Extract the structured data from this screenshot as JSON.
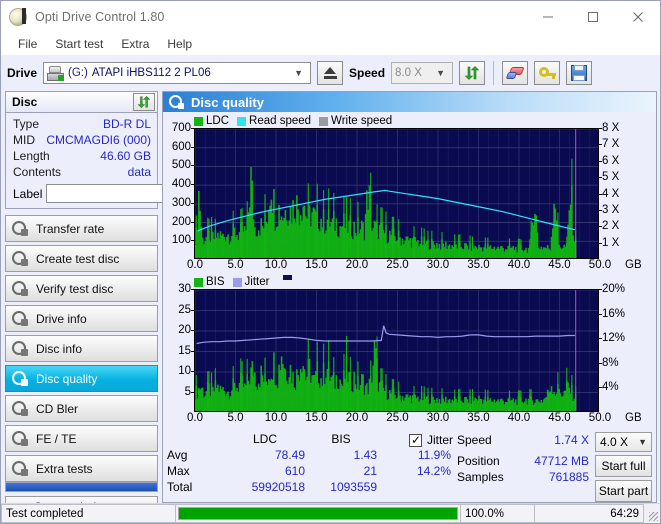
{
  "window": {
    "title": "Opti Drive Control 1.80",
    "icon": "app-disc-icon",
    "minimize": "–",
    "maximize": "□",
    "close": "✕"
  },
  "menu": {
    "items": [
      "File",
      "Start test",
      "Extra",
      "Help"
    ]
  },
  "toolbar": {
    "drive_label": "Drive",
    "drive_letter": "(G:)",
    "drive_name": "ATAPI iHBS112  2 PL06",
    "eject_title": "Eject",
    "speed_label": "Speed",
    "speed_value": "8.0 X",
    "icons": [
      "refresh-icon",
      "eraser-icon",
      "key-icon",
      "save-icon"
    ]
  },
  "disc": {
    "header": "Disc",
    "refresh_icon": "refresh-icon",
    "rows": [
      {
        "key": "Type",
        "value": "BD-R DL"
      },
      {
        "key": "MID",
        "value": "CMCMAGDI6 (000)"
      },
      {
        "key": "Length",
        "value": "46.60 GB"
      },
      {
        "key": "Contents",
        "value": "data"
      }
    ],
    "label_key": "Label",
    "label_value": "",
    "label_placeholder": ""
  },
  "sidebar": {
    "items": [
      {
        "label": "Transfer rate",
        "selected": false
      },
      {
        "label": "Create test disc",
        "selected": false
      },
      {
        "label": "Verify test disc",
        "selected": false
      },
      {
        "label": "Drive info",
        "selected": false
      },
      {
        "label": "Disc info",
        "selected": false
      },
      {
        "label": "Disc quality",
        "selected": true
      },
      {
        "label": "CD Bler",
        "selected": false
      },
      {
        "label": "FE / TE",
        "selected": false
      },
      {
        "label": "Extra tests",
        "selected": false
      }
    ],
    "status_button": "Status window >>"
  },
  "main": {
    "title": "Disc quality",
    "icon": "disc-quality-icon"
  },
  "chart_data": [
    {
      "type": "area",
      "title": "LDC / Read speed",
      "legend": [
        {
          "label": "LDC",
          "color": "#12b512"
        },
        {
          "label": "Read speed",
          "color": "#31e2f5"
        },
        {
          "label": "Write speed",
          "color": "#9a9a9a"
        }
      ],
      "legend_position": "top-left",
      "xlabel": "GB",
      "x_ticks": [
        "0.0",
        "5.0",
        "10.0",
        "15.0",
        "20.0",
        "25.0",
        "30.0",
        "35.0",
        "40.0",
        "45.0",
        "50.0"
      ],
      "xlim": [
        0,
        50
      ],
      "ylabel": "LDC",
      "y_ticks": [
        "100",
        "200",
        "300",
        "400",
        "500",
        "600",
        "700"
      ],
      "ylim": [
        0,
        700
      ],
      "y2label": "Speed",
      "y2_ticks": [
        "1 X",
        "2 X",
        "3 X",
        "4 X",
        "5 X",
        "6 X",
        "7 X",
        "8 X"
      ],
      "y2lim": [
        0,
        8
      ],
      "grid": true,
      "background": "#0a0a50",
      "end_marker_gb": 47.0,
      "series": [
        {
          "name": "LDC",
          "type": "area",
          "color": "#12b512",
          "x": [
            0.2,
            0.5,
            0.9,
            1.4,
            1.9,
            2.4,
            2.9,
            3.4,
            3.9,
            4.4,
            4.9,
            5.4,
            5.9,
            6.4,
            6.9,
            7.4,
            7.9,
            8.4,
            8.9,
            9.4,
            9.9,
            10.4,
            10.9,
            11.4,
            11.9,
            12.4,
            12.9,
            13.4,
            13.9,
            14.4,
            14.9,
            15.4,
            15.9,
            16.4,
            16.9,
            17.4,
            17.9,
            18.4,
            18.9,
            19.4,
            19.9,
            20.4,
            20.9,
            21.4,
            21.9,
            22.4,
            22.9,
            23.4,
            23.9,
            24.4,
            24.9,
            25.4,
            25.9,
            26.4,
            26.9,
            27.4,
            27.9,
            28.4,
            28.9,
            29.4,
            29.9,
            30.4,
            30.9,
            31.4,
            31.9,
            32.4,
            32.9,
            33.4,
            33.9,
            34.4,
            34.9,
            35.4,
            35.9,
            36.4,
            36.9,
            37.4,
            37.9,
            38.4,
            38.9,
            39.4,
            39.9,
            40.4,
            40.9,
            41.4,
            41.9,
            42.4,
            42.9,
            43.4,
            43.9,
            44.4,
            44.9,
            45.4,
            45.9,
            46.4,
            46.9
          ],
          "y": [
            180,
            520,
            150,
            165,
            175,
            160,
            185,
            170,
            195,
            180,
            205,
            190,
            215,
            200,
            610,
            230,
            260,
            240,
            300,
            610,
            340,
            380,
            330,
            400,
            360,
            420,
            380,
            440,
            300,
            350,
            300,
            320,
            280,
            300,
            260,
            280,
            250,
            260,
            240,
            250,
            230,
            240,
            225,
            520,
            250,
            230,
            220,
            200,
            190,
            175,
            170,
            160,
            150,
            145,
            140,
            135,
            130,
            125,
            120,
            118,
            115,
            112,
            110,
            108,
            106,
            104,
            102,
            100,
            98,
            96,
            95,
            94,
            93,
            92,
            91,
            90,
            89,
            88,
            87,
            86,
            85,
            84,
            83,
            82,
            470,
            100,
            95,
            90,
            88,
            530,
            110,
            100,
            95,
            500,
            120
          ]
        },
        {
          "name": "Read speed",
          "type": "line",
          "color": "#31e2f5",
          "axis": "y2",
          "x": [
            0.2,
            2,
            4,
            6,
            8,
            10,
            12,
            14,
            16,
            18,
            20,
            22,
            23.5,
            24,
            26,
            28,
            30,
            32,
            34,
            36,
            38,
            40,
            42,
            44,
            46,
            46.9
          ],
          "y": [
            1.75,
            2.1,
            2.4,
            2.65,
            2.9,
            3.1,
            3.3,
            3.5,
            3.7,
            3.85,
            4.0,
            4.15,
            4.25,
            4.2,
            4.05,
            3.9,
            3.75,
            3.55,
            3.35,
            3.15,
            2.95,
            2.7,
            2.45,
            2.2,
            1.95,
            1.85
          ]
        },
        {
          "name": "Write speed",
          "type": "line",
          "color": "#9a9a9a",
          "x": [],
          "y": []
        }
      ]
    },
    {
      "type": "area",
      "title": "BIS / Jitter",
      "legend": [
        {
          "label": "BIS",
          "color": "#12b512"
        },
        {
          "label": "Jitter",
          "color": "#9a9aee"
        }
      ],
      "legend_position": "top-left",
      "xlabel": "GB",
      "x_ticks": [
        "0.0",
        "5.0",
        "10.0",
        "15.0",
        "20.0",
        "25.0",
        "30.0",
        "35.0",
        "40.0",
        "45.0",
        "50.0"
      ],
      "xlim": [
        0,
        50
      ],
      "ylabel": "BIS",
      "y_ticks": [
        "5",
        "10",
        "15",
        "20",
        "25",
        "30"
      ],
      "ylim": [
        0,
        30
      ],
      "y2label": "Jitter",
      "y2_ticks": [
        "4%",
        "8%",
        "12%",
        "16%",
        "20%"
      ],
      "y2lim": [
        0,
        20
      ],
      "grid": true,
      "background": "#0a0a50",
      "end_marker_gb": 47.0,
      "series": [
        {
          "name": "BIS",
          "type": "area",
          "color": "#12b512",
          "x": [
            0.2,
            0.7,
            1.2,
            1.7,
            2.2,
            2.7,
            3.2,
            3.7,
            4.2,
            4.7,
            5.2,
            5.7,
            6.2,
            6.7,
            7.2,
            7.7,
            8.2,
            8.7,
            9.2,
            9.7,
            10.2,
            10.7,
            11.2,
            11.7,
            12.2,
            12.7,
            13.2,
            13.7,
            14.2,
            14.7,
            15.2,
            15.7,
            16.2,
            16.7,
            17.2,
            17.7,
            18.2,
            18.7,
            19.2,
            19.7,
            20.2,
            20.7,
            21.2,
            21.7,
            22.2,
            22.7,
            23.2,
            23.7,
            24.2,
            24.7,
            25.2,
            25.7,
            26.2,
            26.7,
            27.2,
            27.7,
            28.2,
            28.7,
            29.2,
            29.7,
            30.2,
            31,
            32,
            33,
            34,
            35,
            36,
            37,
            38,
            39,
            40,
            41,
            42,
            43,
            43.5,
            44,
            44.5,
            45,
            45.5,
            46,
            46.5,
            46.9
          ],
          "y": [
            7,
            9,
            6.5,
            8,
            7,
            9,
            7.5,
            8,
            7,
            8.5,
            9,
            10,
            8,
            12,
            15,
            11,
            13,
            10,
            14,
            17,
            12,
            21,
            14,
            16,
            11,
            13,
            20,
            12,
            15,
            10,
            14,
            11,
            16,
            12,
            10,
            13,
            9,
            14,
            10,
            12,
            9,
            11,
            8,
            10,
            21,
            9,
            8,
            7,
            6.5,
            6,
            5.8,
            5.5,
            5.3,
            5.2,
            5,
            5,
            4.9,
            4.8,
            4.7,
            4.6,
            4.5,
            4.5,
            4.4,
            4.4,
            4.3,
            5,
            4.3,
            4.2,
            4.2,
            4.1,
            4.1,
            4.5,
            4.2,
            4.3,
            6,
            10,
            7,
            8,
            6,
            9,
            7,
            5.5,
            5
          ]
        },
        {
          "name": "Jitter",
          "type": "line",
          "color": "#9a9aee",
          "axis": "y2",
          "x": [
            0.2,
            1,
            2,
            3,
            4,
            5,
            6,
            7,
            8,
            9,
            10,
            11,
            12,
            13,
            14,
            15,
            16,
            17,
            18,
            19,
            20,
            21,
            22,
            23,
            23.3,
            23.6,
            24,
            25,
            26,
            27,
            28,
            29,
            30,
            31,
            32,
            33,
            34,
            35,
            36,
            37,
            38,
            39,
            40,
            41,
            42,
            43,
            44,
            45,
            46,
            46.9
          ],
          "y": [
            11.3,
            11.5,
            11.6,
            11.6,
            11.7,
            11.7,
            11.8,
            11.9,
            12.0,
            12.1,
            12.2,
            12.3,
            12.3,
            12.2,
            12.0,
            11.8,
            11.7,
            11.7,
            11.7,
            11.7,
            11.7,
            11.7,
            11.7,
            11.8,
            14.2,
            13.0,
            12.8,
            12.7,
            12.6,
            12.5,
            12.4,
            12.4,
            12.3,
            12.4,
            12.4,
            12.5,
            12.7,
            12.7,
            12.5,
            12.4,
            12.4,
            12.4,
            12.4,
            12.4,
            12.5,
            12.5,
            12.5,
            12.5,
            12.6,
            12.6
          ]
        }
      ]
    }
  ],
  "stats": {
    "columns": [
      "LDC",
      "BIS"
    ],
    "jitter_label": "Jitter",
    "jitter_checked": true,
    "rows": [
      {
        "label": "Avg",
        "ldc": "78.49",
        "bis": "1.43",
        "jitter": "11.9%"
      },
      {
        "label": "Max",
        "ldc": "610",
        "bis": "21",
        "jitter": "14.2%"
      },
      {
        "label": "Total",
        "ldc": "59920518",
        "bis": "1093559",
        "jitter": ""
      }
    ]
  },
  "readout": {
    "speed_label": "Speed",
    "speed_value": "1.74 X",
    "position_label": "Position",
    "position_value": "47712 MB",
    "samples_label": "Samples",
    "samples_value": "761885",
    "speed_select": "4.0 X",
    "start_full": "Start full",
    "start_part": "Start part"
  },
  "statusbar": {
    "message": "Test completed",
    "progress_percent": 100,
    "percent_text": "100.0%",
    "elapsed": "64:29"
  },
  "colors": {
    "accent": "#06b2e2",
    "plot_bg": "#0a0a50",
    "ldc_green": "#12b512",
    "read_cyan": "#31e2f5",
    "jitter_purple": "#9a9aee",
    "value_blue": "#2727c8",
    "progress_green": "#00a400",
    "marker_magenta": "#d63fd6"
  }
}
